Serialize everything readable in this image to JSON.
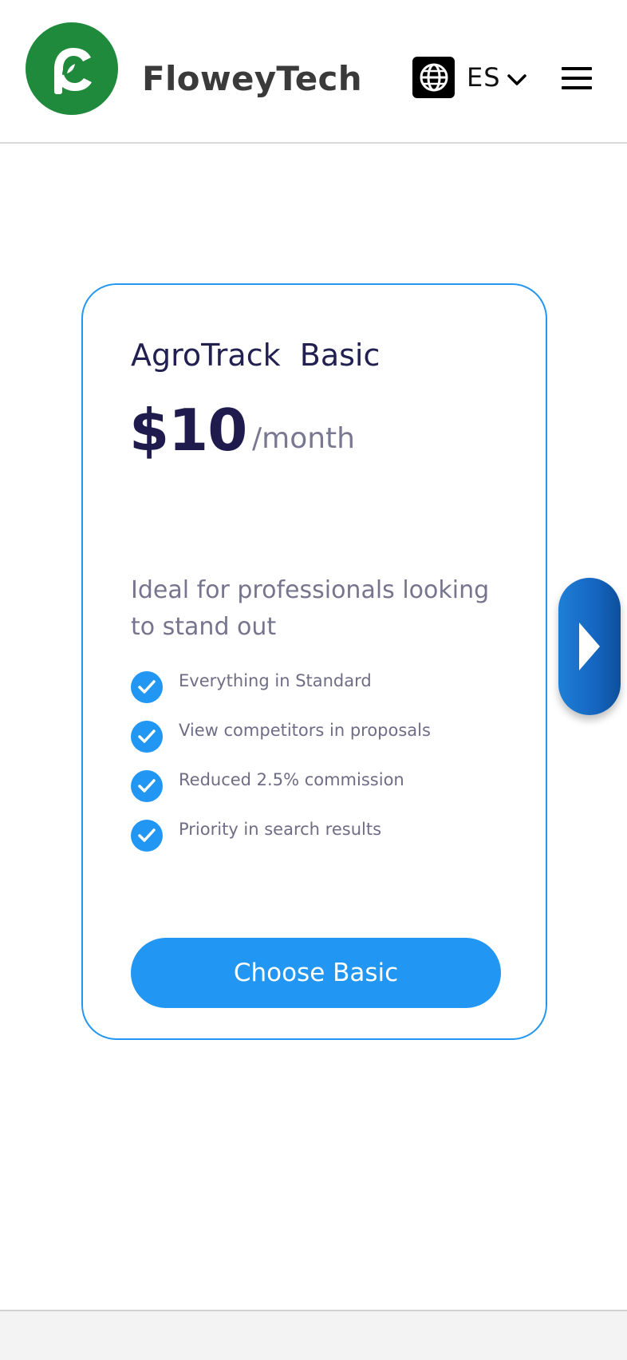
{
  "header": {
    "brand": "FloweyTech",
    "language": {
      "code": "ES",
      "icon": "globe-icon"
    },
    "menu_icon": "hamburger-menu-icon",
    "logo_color": "#1f8a3b"
  },
  "plan": {
    "name": "AgroTrack  Basic",
    "price": "$10",
    "period": "/month",
    "description": "Ideal for professionals looking to stand out",
    "features": [
      "Everything in Standard",
      "View competitors in proposals",
      "Reduced 2.5% commission",
      "Priority in search results"
    ],
    "cta_label": "Choose Basic",
    "accent_color": "#2196f3"
  },
  "carousel": {
    "next_icon": "chevron-right-icon"
  }
}
